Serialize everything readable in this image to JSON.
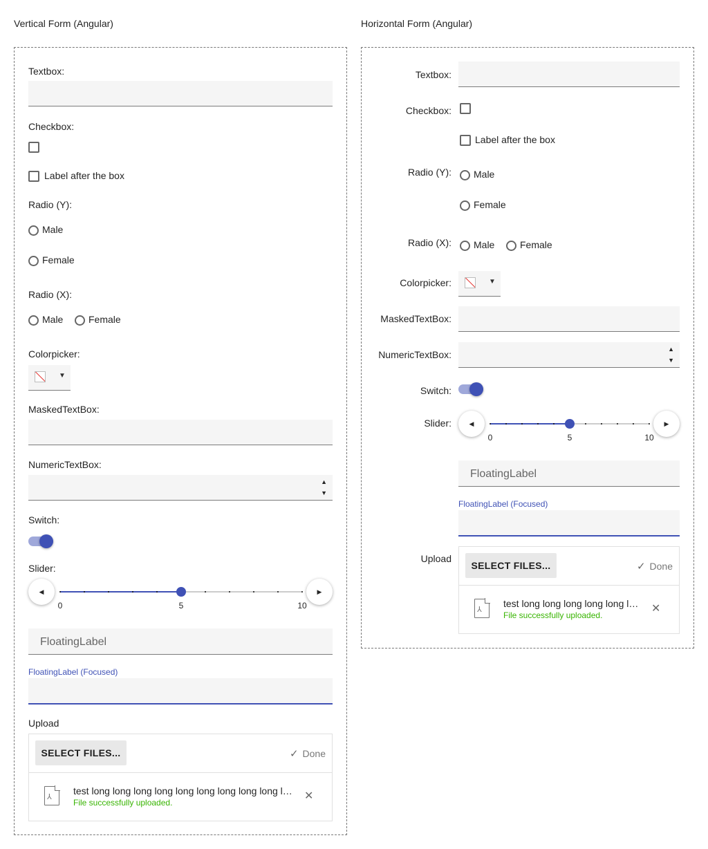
{
  "vertical": {
    "title": "Vertical Form (Angular)",
    "textbox_label": "Textbox:",
    "checkbox_label": "Checkbox:",
    "checkbox_after_label": "Label after the box",
    "radio_y_label": "Radio (Y):",
    "radio_x_label": "Radio (X):",
    "radio_options": [
      "Male",
      "Female"
    ],
    "colorpicker_label": "Colorpicker:",
    "masked_label": "MaskedTextBox:",
    "numeric_label": "NumericTextBox:",
    "switch_label": "Switch:",
    "switch_on": true,
    "slider_label": "Slider:",
    "floating_label": "FloatingLabel",
    "floating_focused_label": "FloatingLabel (Focused)",
    "upload_label": "Upload",
    "select_files": "SELECT FILES...",
    "done": "Done",
    "file_name": "test long long long long long long long long long long long.pdf",
    "file_status": "File successfully uploaded."
  },
  "horizontal": {
    "title": "Horizontal Form (Angular)",
    "textbox_label": "Textbox:",
    "checkbox_label": "Checkbox:",
    "checkbox_after_label": "Label after the box",
    "radio_y_label": "Radio (Y):",
    "radio_x_label": "Radio (X):",
    "radio_options": [
      "Male",
      "Female"
    ],
    "colorpicker_label": "Colorpicker:",
    "masked_label": "MaskedTextBox:",
    "numeric_label": "NumericTextBox:",
    "switch_label": "Switch:",
    "switch_on": true,
    "slider_label": "Slider:",
    "floating_label": "FloatingLabel",
    "floating_focused_label": "FloatingLabel (Focused)",
    "upload_label": "Upload",
    "select_files": "SELECT FILES...",
    "done": "Done",
    "file_name": "test long long long long long long long long long long long.pdf",
    "file_status": "File successfully uploaded."
  },
  "slider": {
    "min": 0,
    "max": 10,
    "value": 5,
    "tick_step": 1,
    "tick_labels": [
      "0",
      "5",
      "10"
    ]
  },
  "colors": {
    "accent": "#3f51b5",
    "switch_track": "#9fa8da",
    "success": "#37b400",
    "field_bg": "#f5f5f5"
  },
  "icons": {
    "spinner_up": "▲",
    "spinner_down": "▼",
    "caret": "▼",
    "slider_prev": "◀",
    "slider_next": "▶",
    "check": "✓",
    "remove": "✕",
    "file": "file-pdf-icon"
  }
}
